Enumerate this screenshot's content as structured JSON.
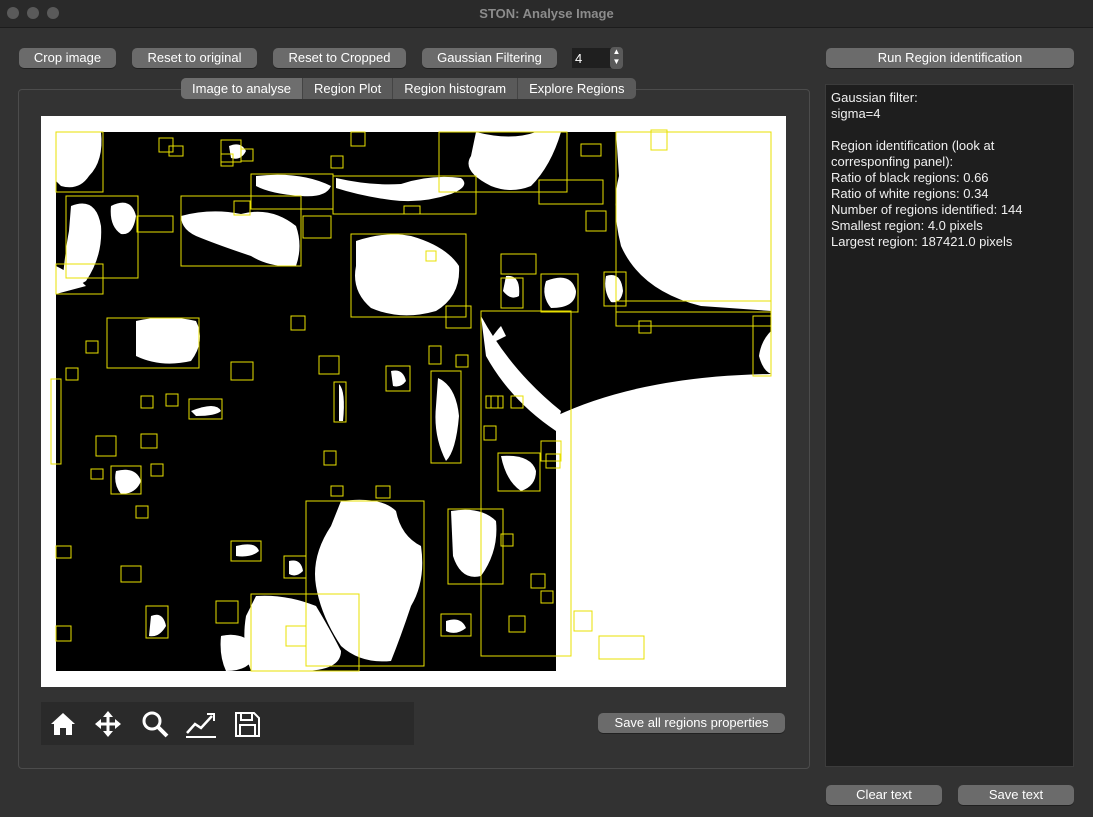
{
  "window": {
    "title": "STON: Analyse Image",
    "traffic_lights": [
      "close",
      "minimize",
      "zoom"
    ]
  },
  "toolbar_top": {
    "crop": "Crop image",
    "reset_original": "Reset to original",
    "reset_cropped": "Reset to Cropped",
    "gaussian": "Gaussian Filtering",
    "sigma_value": "4",
    "run_region": "Run Region identification"
  },
  "tabs": [
    {
      "label": "Image to analyse",
      "active": true
    },
    {
      "label": "Region Plot",
      "active": false
    },
    {
      "label": "Region histogram",
      "active": false
    },
    {
      "label": "Explore Regions",
      "active": false
    }
  ],
  "plot_toolbar": {
    "icons": [
      "home-icon",
      "pan-icon",
      "zoom-icon",
      "subplots-icon",
      "save-icon"
    ],
    "save_regions": "Save all regions properties"
  },
  "log": {
    "text": "Gaussian filter:\nsigma=4\n\nRegion identification (look at\ncorresponfing panel):\nRatio of black regions: 0.66\nRatio of white regions: 0.34\nNumber of regions identified: 144\nSmallest region: 4.0 pixels\nLargest region: 187421.0 pixels"
  },
  "bottom_buttons": {
    "clear": "Clear text",
    "save": "Save text"
  },
  "colors": {
    "box": "#e8e000",
    "button": "#6b6b6b",
    "panel": "#1e1e1e"
  }
}
